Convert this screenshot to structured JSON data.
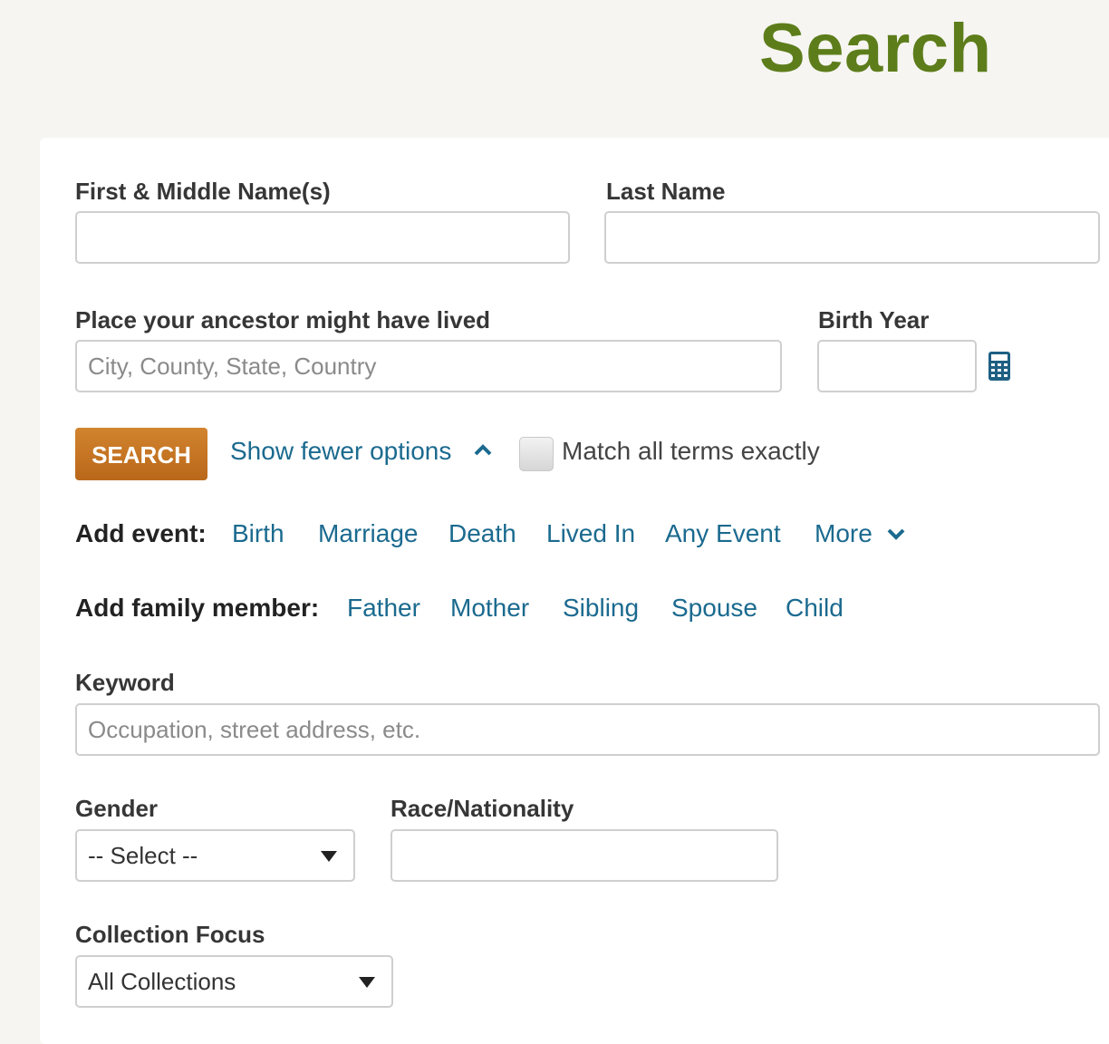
{
  "page": {
    "title": "Search"
  },
  "form": {
    "first_name": {
      "label": "First & Middle Name(s)",
      "value": "",
      "placeholder": ""
    },
    "last_name": {
      "label": "Last Name",
      "value": "",
      "placeholder": ""
    },
    "place": {
      "label": "Place your ancestor might have lived",
      "value": "",
      "placeholder": "City, County, State, Country"
    },
    "birth_year": {
      "label": "Birth Year",
      "value": "",
      "placeholder": ""
    },
    "search_button": "SEARCH",
    "fewer_options": "Show fewer options",
    "match_exact": {
      "label": "Match all terms exactly",
      "checked": false
    },
    "add_event": {
      "label": "Add event:",
      "items": [
        "Birth",
        "Marriage",
        "Death",
        "Lived In",
        "Any Event",
        "More"
      ]
    },
    "add_family": {
      "label": "Add family member:",
      "items": [
        "Father",
        "Mother",
        "Sibling",
        "Spouse",
        "Child"
      ]
    },
    "keyword": {
      "label": "Keyword",
      "value": "",
      "placeholder": "Occupation, street address, etc."
    },
    "gender": {
      "label": "Gender",
      "selected": "-- Select --"
    },
    "race": {
      "label": "Race/Nationality",
      "value": ""
    },
    "collection_focus": {
      "label": "Collection Focus",
      "selected": "All Collections"
    }
  },
  "colors": {
    "title_green": "#5d7d1b",
    "link_blue": "#1b6a8f",
    "button_orange": "#c5782a",
    "background": "#f6f5f1"
  },
  "icons": {
    "birth_year_picker": "calculator-icon",
    "fewer_options": "chevron-up-icon",
    "more_events": "chevron-down-icon"
  }
}
